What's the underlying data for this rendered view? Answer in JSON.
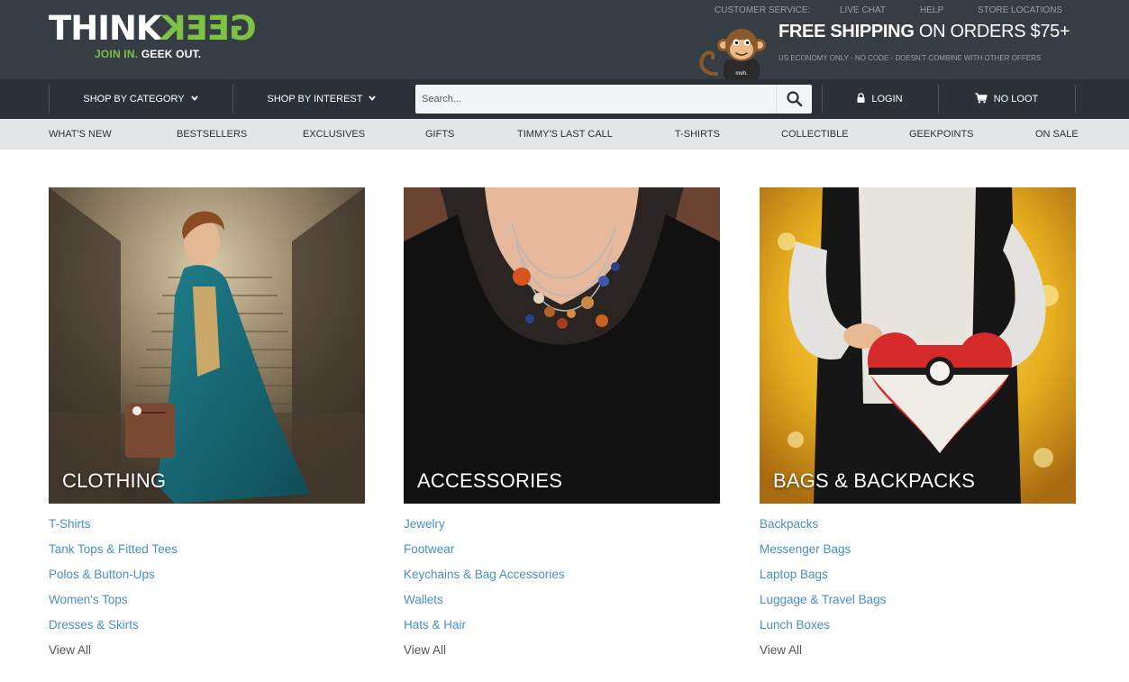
{
  "header": {
    "logo": {
      "think": "THINK",
      "geek": "GEEK",
      "tagline_green": "JOIN IN.",
      "tagline_white": "GEEK OUT.",
      "trademark": "®"
    },
    "utility_links": [
      "CUSTOMER SERVICE:",
      "LIVE CHAT",
      "HELP",
      "STORE LOCATIONS"
    ],
    "shipping": {
      "bold": "FREE SHIPPING",
      "rest": "ON ORDERS $75+",
      "fine_print": "US ECONOMY ONLY - NO CODE - DOESN'T COMBINE WITH OTHER OFFERS"
    },
    "mascot_shirt": "meh."
  },
  "nav": {
    "shop_by_category": "SHOP BY CATEGORY",
    "shop_by_interest": "SHOP BY INTEREST",
    "search_placeholder": "Search...",
    "login": "LOGIN",
    "cart": "NO LOOT"
  },
  "subnav": [
    "WHAT'S NEW",
    "BESTSELLERS",
    "EXCLUSIVES",
    "GIFTS",
    "TIMMY'S LAST CALL",
    "T-SHIRTS",
    "COLLECTIBLE",
    "GEEKPOINTS",
    "ON SALE"
  ],
  "categories": [
    {
      "title": "CLOTHING",
      "links": [
        "T-Shirts",
        "Tank Tops & Fitted Tees",
        "Polos & Button-Ups",
        "Women's Tops",
        "Dresses & Skirts"
      ],
      "view_all": "View All"
    },
    {
      "title": "ACCESSORIES",
      "links": [
        "Jewelry",
        "Footwear",
        "Keychains & Bag Accessories",
        "Wallets",
        "Hats & Hair"
      ],
      "view_all": "View All"
    },
    {
      "title": "BAGS & BACKPACKS",
      "links": [
        "Backpacks",
        "Messenger Bags",
        "Laptop Bags",
        "Luggage & Travel Bags",
        "Lunch Boxes"
      ],
      "view_all": "View All"
    }
  ],
  "colors": {
    "header_bg": "#363d44",
    "nav_bg": "#2b3137",
    "subnav_bg": "#e4e6e8",
    "brand_green": "#7dc242",
    "link_blue": "#4a8fc4"
  },
  "icons": [
    "chevron-down-icon",
    "search-icon",
    "lock-icon",
    "cart-icon",
    "monkey-mascot-icon"
  ]
}
